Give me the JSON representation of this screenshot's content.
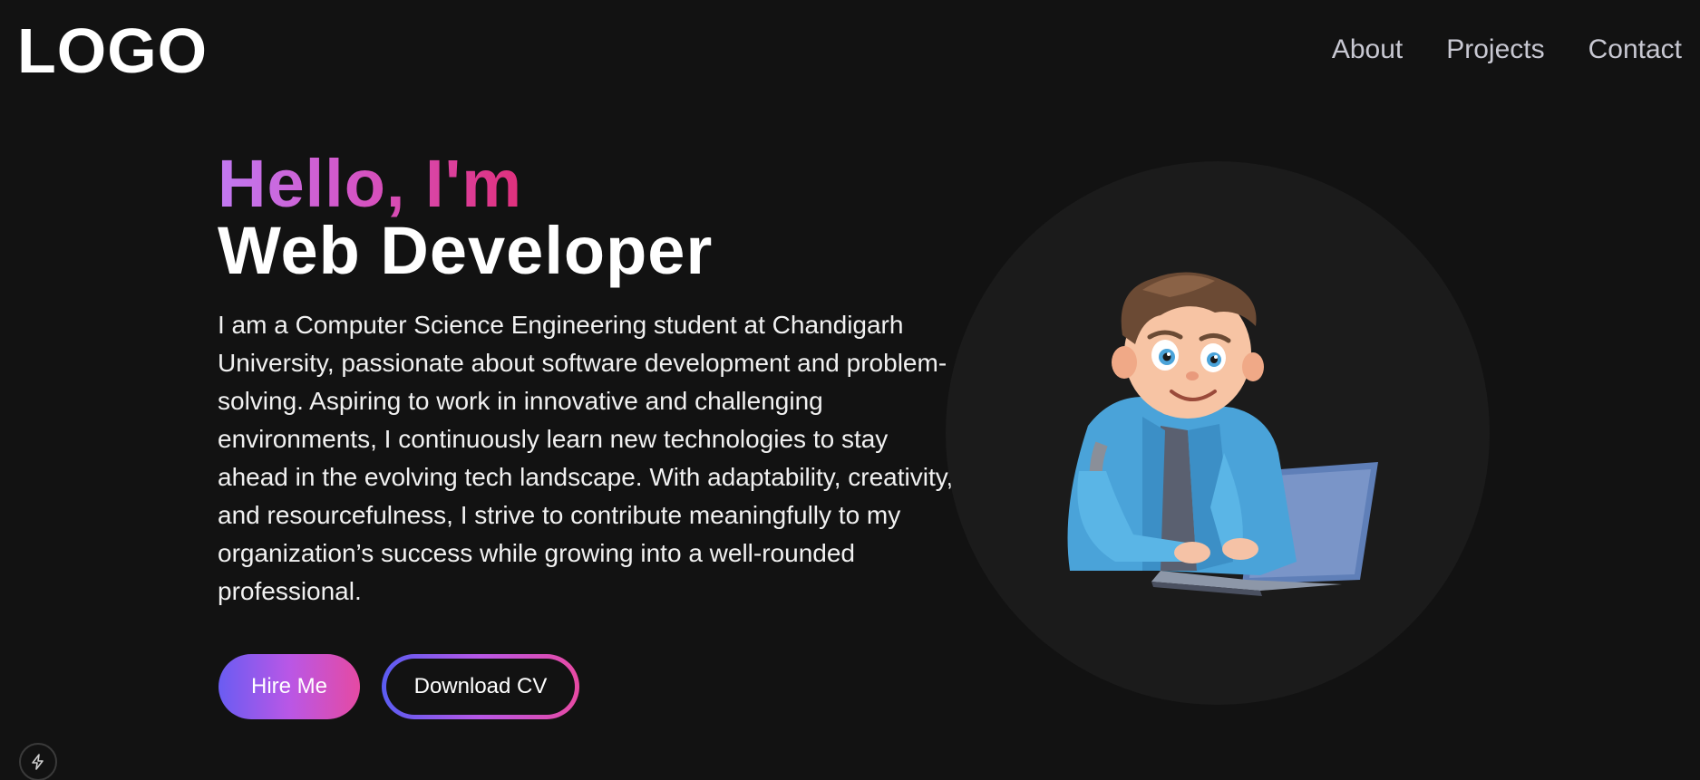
{
  "header": {
    "logo": "LOGO",
    "nav": [
      "About",
      "Projects",
      "Contact"
    ]
  },
  "hero": {
    "greeting": "Hello, I'm",
    "role": "Web Developer",
    "bio": "I am a Computer Science Engineering student at Chandigarh University, passionate about software development and problem-solving. Aspiring to work in innovative and challenging environments, I continuously learn new technologies to stay ahead in the evolving tech landscape. With adaptability, creativity, and resourcefulness, I strive to contribute meaningfully to my organization’s success while growing into a well-rounded professional.",
    "hire_label": "Hire Me",
    "cv_label": "Download CV"
  },
  "colors": {
    "background": "#121212",
    "circle": "#1b1b1b",
    "gradient_start": "#c179f2",
    "gradient_end": "#e0307c",
    "button_gradient_start": "#6a5cf2",
    "button_gradient_end": "#e54aa3"
  },
  "icons": {
    "avatar": "developer-avatar-illustration",
    "bolt": "lightning-bolt-icon"
  }
}
